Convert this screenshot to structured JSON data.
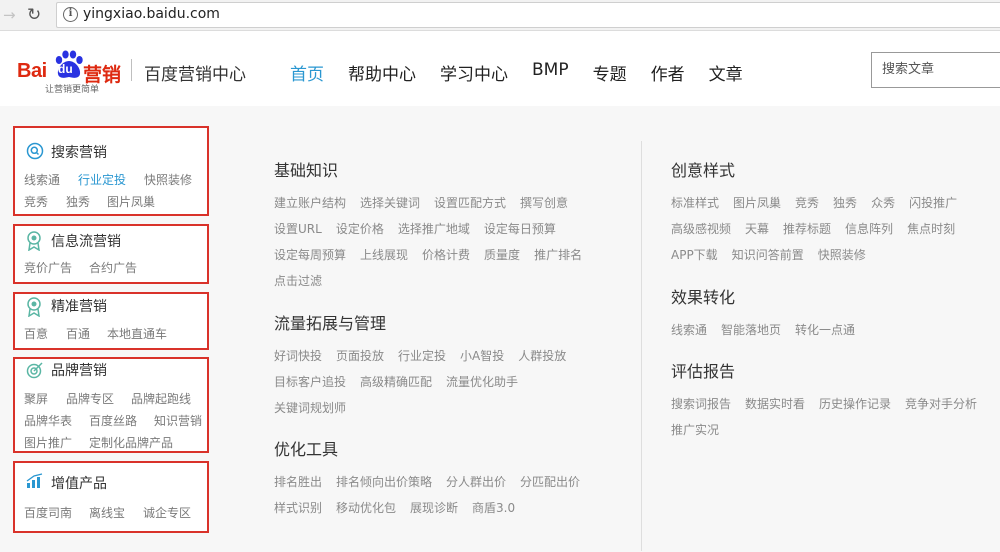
{
  "browser": {
    "url": "yingxiao.baidu.com"
  },
  "logo": {
    "bai": "Bai",
    "du": "du",
    "yingxiao": "营销",
    "slogan": "让营销更简单"
  },
  "site_name": "百度营销中心",
  "nav": [
    {
      "label": "首页",
      "active": true
    },
    {
      "label": "帮助中心"
    },
    {
      "label": "学习中心"
    },
    {
      "label": "BMP"
    },
    {
      "label": "专题"
    },
    {
      "label": "作者"
    },
    {
      "label": "文章"
    }
  ],
  "search": {
    "placeholder": "搜索文章"
  },
  "sidebar": {
    "search_marketing": {
      "title": "搜索营销",
      "links": [
        "线索通",
        "行业定投",
        "快照装修",
        "竞秀",
        "独秀",
        "图片凤巢"
      ]
    },
    "feed_marketing": {
      "title": "信息流营销",
      "links": [
        "竞价广告",
        "合约广告"
      ]
    },
    "precision_marketing": {
      "title": "精准营销",
      "links": [
        "百意",
        "百通",
        "本地直通车"
      ]
    },
    "brand_marketing": {
      "title": "品牌营销",
      "links": [
        "聚屏",
        "品牌专区",
        "品牌起跑线",
        "品牌华表",
        "百度丝路",
        "知识营销",
        "图片推广",
        "定制化品牌产品"
      ]
    },
    "value_added": {
      "title": "增值产品",
      "links": [
        "百度司南",
        "离线宝",
        "诚企专区"
      ]
    }
  },
  "main": {
    "basics": {
      "title": "基础知识",
      "rows": [
        [
          "建立账户结构",
          "选择关键词",
          "设置匹配方式",
          "撰写创意"
        ],
        [
          "设置URL",
          "设定价格",
          "选择推广地域",
          "设定每日预算"
        ],
        [
          "设定每周预算",
          "上线展现",
          "价格计费",
          "质量度",
          "推广排名"
        ],
        [
          "点击过滤"
        ]
      ]
    },
    "traffic": {
      "title": "流量拓展与管理",
      "rows": [
        [
          "好词快投",
          "页面投放",
          "行业定投",
          "小A智投",
          "人群投放"
        ],
        [
          "目标客户追投",
          "高级精确匹配",
          "流量优化助手"
        ],
        [
          "关键词规划师"
        ]
      ]
    },
    "tools": {
      "title": "优化工具",
      "rows": [
        [
          "排名胜出",
          "排名倾向出价策略",
          "分人群出价",
          "分匹配出价"
        ],
        [
          "样式识别",
          "移动优化包",
          "展现诊断",
          "商盾3.0"
        ]
      ]
    },
    "creative": {
      "title": "创意样式",
      "rows": [
        [
          "标准样式",
          "图片凤巢",
          "竞秀",
          "独秀",
          "众秀",
          "闪投推广"
        ],
        [
          "高级感视频",
          "天幕",
          "推荐标题",
          "信息阵列",
          "焦点时刻"
        ],
        [
          "APP下载",
          "知识问答前置",
          "快照装修"
        ]
      ]
    },
    "conversion": {
      "title": "效果转化",
      "rows": [
        [
          "线索通",
          "智能落地页",
          "转化一点通"
        ]
      ]
    },
    "reports": {
      "title": "评估报告",
      "rows": [
        [
          "搜索词报告",
          "数据实时看",
          "历史操作记录",
          "竞争对手分析"
        ],
        [
          "推广实况"
        ]
      ]
    }
  }
}
